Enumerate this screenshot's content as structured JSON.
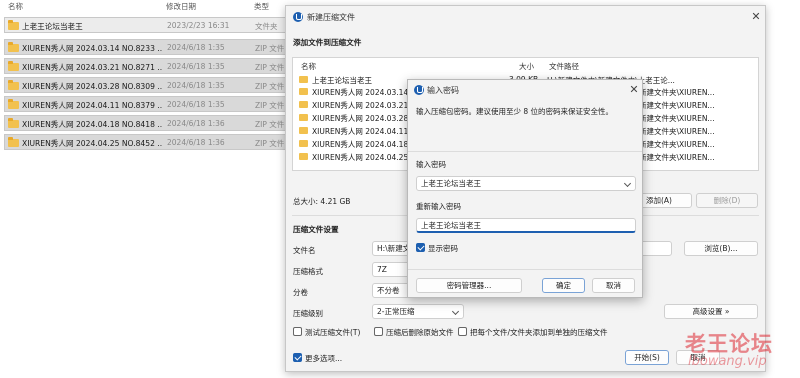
{
  "explorer": {
    "headers": {
      "name": "名称",
      "modified": "修改日期",
      "type": "类型",
      "size": "大小"
    },
    "rows": [
      {
        "name": "上老王论坛当老王",
        "date": "2023/2/23 16:31",
        "type": "文件夹",
        "icon": "folder-icon"
      },
      {
        "name": "XIUREN秀人网 2024.03.14 NO.8233 ...",
        "date": "2024/6/18 1:35",
        "type": "ZIP 文件",
        "icon": "folder-zip-icon"
      },
      {
        "name": "XIUREN秀人网 2024.03.21 NO.8271 ...",
        "date": "2024/6/18 1:35",
        "type": "ZIP 文件",
        "icon": "folder-zip-icon"
      },
      {
        "name": "XIUREN秀人网 2024.03.28 NO.8309 ...",
        "date": "2024/6/18 1:35",
        "type": "ZIP 文件",
        "icon": "folder-zip-icon"
      },
      {
        "name": "XIUREN秀人网 2024.04.11 NO.8379 ...",
        "date": "2024/6/18 1:35",
        "type": "ZIP 文件",
        "icon": "folder-zip-icon"
      },
      {
        "name": "XIUREN秀人网 2024.04.18 NO.8418 ...",
        "date": "2024/6/18 1:36",
        "type": "ZIP 文件",
        "icon": "folder-zip-icon"
      },
      {
        "name": "XIUREN秀人网 2024.04.25 NO.8452 ...",
        "date": "2024/6/18 1:36",
        "type": "ZIP 文件",
        "icon": "folder-zip-icon"
      }
    ]
  },
  "archive": {
    "title": "新建压缩文件",
    "add_section": "添加文件到压缩文件",
    "list_headers": {
      "name": "名称",
      "size": "大小",
      "path": "文件路径"
    },
    "files": [
      {
        "name": "上老王论坛当老王",
        "size": "3.09 KB",
        "path": "H:\\新建文件夹\\新建文件夹\\上老王论..."
      },
      {
        "name": "XIUREN秀人网 2024.03.14 NO",
        "size": "",
        "path": "新建文件夹\\XIUREN..."
      },
      {
        "name": "XIUREN秀人网 2024.03.21 NO",
        "size": "",
        "path": "新建文件夹\\XIUREN..."
      },
      {
        "name": "XIUREN秀人网 2024.03.28 NO",
        "size": "",
        "path": "新建文件夹\\XIUREN..."
      },
      {
        "name": "XIUREN秀人网 2024.04.11 NO",
        "size": "",
        "path": "新建文件夹\\XIUREN..."
      },
      {
        "name": "XIUREN秀人网 2024.04.18 NO",
        "size": "",
        "path": "新建文件夹\\XIUREN..."
      },
      {
        "name": "XIUREN秀人网 2024.04.25 NO",
        "size": "",
        "path": "新建文件夹\\XIUREN..."
      }
    ],
    "total_size": "总大小: 4.21 GB",
    "add_button": "添加(A)",
    "delete_button": "删除(D)",
    "settings_section": "压缩文件设置",
    "filename_label": "文件名",
    "filename_value": "H:\\新建文",
    "browse_button": "浏览(B)...",
    "format_label": "压缩格式",
    "format_value": "7Z",
    "volume_label": "分卷",
    "volume_value": "不分卷",
    "level_label": "压缩级别",
    "level_value": "2-正常压缩",
    "advanced_button": "高级设置 »",
    "opt_test": "测试压缩文件(T)",
    "opt_delete": "压缩后删除原始文件",
    "opt_each": "把每个文件/文件夹添加到单独的压缩文件",
    "more_options": "更多选项...",
    "start_button": "开始(S)",
    "cancel_button": "取消"
  },
  "password": {
    "title": "输入密码",
    "hint": "输入压缩包密码。建议使用至少 8 位的密码来保证安全性。",
    "enter_label": "输入密码",
    "enter_value": "上老王论坛当老王",
    "reenter_label": "重新输入密码",
    "reenter_value": "上老王论坛当老王",
    "show_label": "显示密码",
    "manager_button": "密码管理器...",
    "ok_button": "确定",
    "cancel_button": "取消"
  },
  "watermark": {
    "line1": "老王论坛",
    "line2": "lbowang.vip"
  },
  "colors": {
    "accent": "#1d5fb0",
    "folder": "#f2c14e",
    "watermark": "#dc2832"
  }
}
